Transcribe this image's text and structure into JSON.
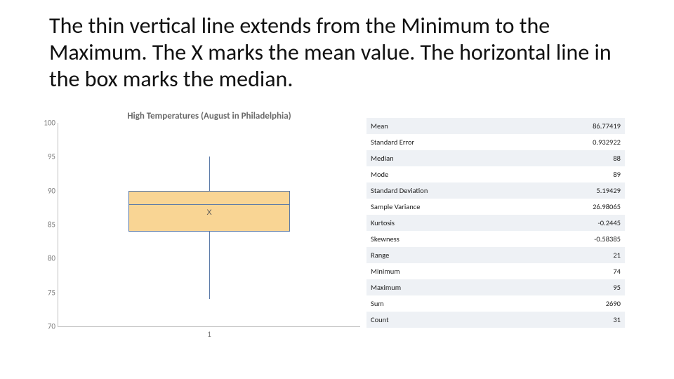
{
  "title_text": "The thin vertical line extends from the Minimum to the Maximum. The X marks the mean value. The horizontal line in the box marks the median.",
  "chart_title": "High Temperatures (August in Philadelphia)",
  "x_category_label": "1",
  "yticks": [
    "70",
    "75",
    "80",
    "85",
    "90",
    "95",
    "100"
  ],
  "stats": [
    {
      "label": "Mean",
      "value": "86.77419"
    },
    {
      "label": "Standard Error",
      "value": "0.932922"
    },
    {
      "label": "Median",
      "value": "88"
    },
    {
      "label": "Mode",
      "value": "89"
    },
    {
      "label": "Standard Deviation",
      "value": "5.19429"
    },
    {
      "label": "Sample Variance",
      "value": "26.98065"
    },
    {
      "label": "Kurtosis",
      "value": "-0.2445"
    },
    {
      "label": "Skewness",
      "value": "-0.58385"
    },
    {
      "label": "Range",
      "value": "21"
    },
    {
      "label": "Minimum",
      "value": "74"
    },
    {
      "label": "Maximum",
      "value": "95"
    },
    {
      "label": "Sum",
      "value": "2690"
    },
    {
      "label": "Count",
      "value": "31"
    }
  ],
  "chart_data": {
    "type": "boxplot",
    "title": "High Temperatures (August in Philadelphia)",
    "xlabel": "",
    "ylabel": "",
    "ylim": [
      70,
      100
    ],
    "categories": [
      "1"
    ],
    "series": [
      {
        "name": "High Temperatures",
        "min": 74,
        "q1": 84,
        "median": 88,
        "q3": 90,
        "max": 95,
        "mean": 86.77419
      }
    ],
    "annotations": [
      "mean marked with X",
      "whiskers span min to max"
    ]
  }
}
